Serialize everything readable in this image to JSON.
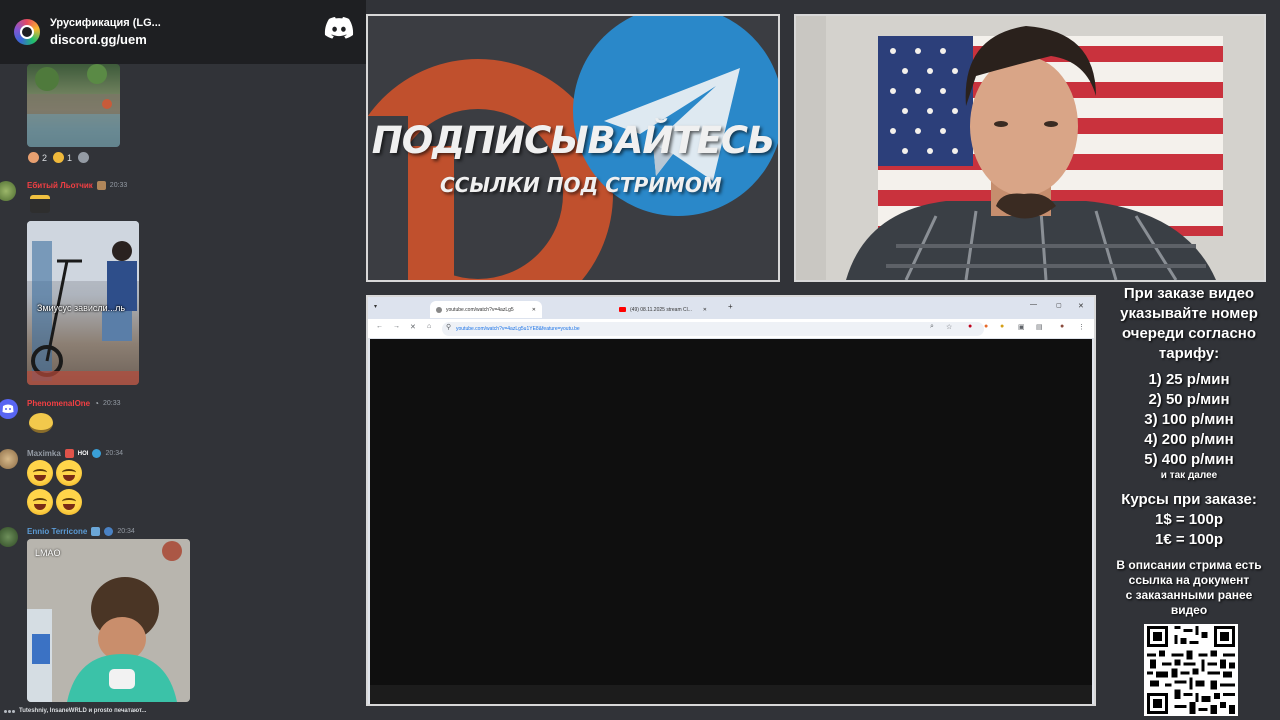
{
  "chat": {
    "server_name": "Урусификация (LG...",
    "server_invite": "discord.gg/uem",
    "reactions": [
      {
        "icon": "face-emoji",
        "count": "2"
      },
      {
        "icon": "laugh-emoji",
        "count": "1"
      },
      {
        "icon": "add-reaction-icon",
        "count": ""
      }
    ],
    "messages": [
      {
        "user": "Ебитый Льотчик",
        "time": "20:33",
        "color": "#f23f43"
      },
      {
        "user": "PhenomenalOne",
        "time": "20:33",
        "color": "#f23f43"
      },
      {
        "user": "Maximka",
        "tag": "HOI",
        "time": "20:34",
        "color": "#949ba4"
      },
      {
        "user": "Ennio Terricone",
        "time": "20:34",
        "color": "#5b9bd5"
      }
    ],
    "image_caption": "Змиусус зависли...ль",
    "gif_label": "LMAO",
    "typing": "Tuteshniy, InsaneWRLD и prosto печатают..."
  },
  "promo": {
    "title": "ПОДПИСЫВАЙТЕСЬ",
    "subtitle": "ССЫЛКИ ПОД СТРИМОМ"
  },
  "browser": {
    "tab1": "youtube.com/watch?v=4azLg5",
    "tab2": "(49) 08.11.2025 stream Cl...",
    "url": "youtube.com/watch?v=4azLg5u1YE8&feature=youtu.be"
  },
  "info": {
    "heading": [
      "При заказе видео",
      "указывайте номер",
      "очереди согласно",
      "тарифу:"
    ],
    "rates": [
      "1) 25 р/мин",
      "2) 50 р/мин",
      "3) 100 р/мин",
      "4) 200 р/мин",
      "5) 400 р/мин"
    ],
    "etc": "и так далее",
    "fx_heading": "Курсы при заказе:",
    "fx": [
      "1$ = 100р",
      "1€ = 100р"
    ],
    "desc": [
      "В описании стрима есть",
      "ссылка на документ",
      "с заказанными ранее",
      "видео"
    ]
  },
  "colors": {
    "discord_bg": "#313338",
    "discord_header": "#1e1f22",
    "blurple": "#5865f2",
    "patreon": "#c0502d",
    "telegram": "#2a88c9"
  }
}
